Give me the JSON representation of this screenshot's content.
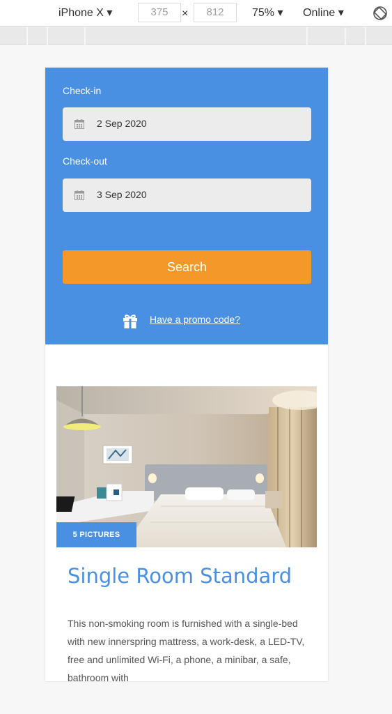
{
  "devtools": {
    "device": "iPhone X ▾",
    "width": "375",
    "times": "×",
    "height": "812",
    "zoom": "75% ▾",
    "network": "Online ▾",
    "rotate_icon": "rotate-icon"
  },
  "booking": {
    "checkin_label": "Check-in",
    "checkin_value": "2 Sep 2020",
    "checkout_label": "Check-out",
    "checkout_value": "3 Sep 2020",
    "calendar_icon": "calendar-icon",
    "search_label": "Search",
    "promo_icon": "gift-icon",
    "promo_label": "Have a promo code?",
    "colors": {
      "panel": "#4a90e2",
      "button": "#f5982a"
    }
  },
  "room": {
    "pictures_badge": "5 PICTURES",
    "title": "Single Room Standard",
    "description": "This non-smoking room is furnished with a single-bed with new innerspring mattress, a work-desk, a LED-TV, free and unlimited Wi-Fi, a phone, a minibar, a safe, bathroom with"
  }
}
